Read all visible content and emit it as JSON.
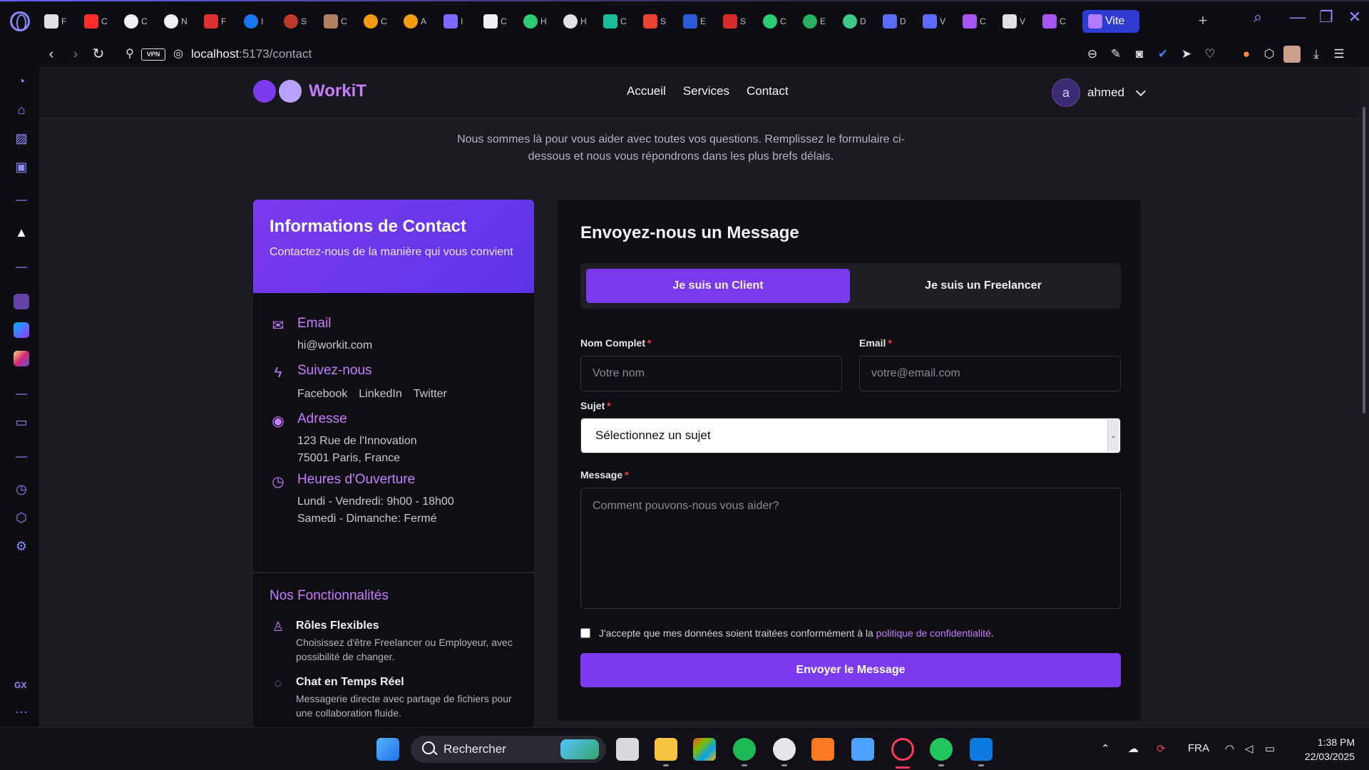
{
  "browser": {
    "active_tab_label": "Vite",
    "tab_letters": [
      "F",
      "C",
      "C",
      "N",
      "F",
      "I",
      "S",
      "C",
      "C",
      "A",
      "I",
      "C",
      "H",
      "H",
      "C",
      "S",
      "E",
      "S",
      "C",
      "E",
      "D",
      "D",
      "V",
      "C",
      "V",
      "C"
    ],
    "url_host": "localhost",
    "url_path": ":5173/contact",
    "vpn_label": "VPN",
    "new_tab": "+",
    "sidebar_gx": "GX",
    "sidebar_more": "···"
  },
  "header": {
    "logo": "WorkiT",
    "nav": [
      "Accueil",
      "Services",
      "Contact"
    ],
    "avatar_letter": "a",
    "username": "ahmed"
  },
  "intro": "Nous sommes là pour vous aider avec toutes vos questions. Remplissez le formulaire ci-dessous et nous vous répondrons dans les plus brefs délais.",
  "info": {
    "title": "Informations de Contact",
    "subtitle": "Contactez-nous de la manière qui vous convient",
    "email_title": "Email",
    "email_value": "hi@workit.com",
    "follow_title": "Suivez-nous",
    "follow_links": [
      "Facebook",
      "LinkedIn",
      "Twitter"
    ],
    "address_title": "Adresse",
    "address_line1": "123 Rue de l'Innovation",
    "address_line2": "75001 Paris, France",
    "hours_title": "Heures d'Ouverture",
    "hours_line1": "Lundi - Vendredi: 9h00 - 18h00",
    "hours_line2": "Samedi - Dimanche: Fermé",
    "features_title": "Nos Fonctionnalités",
    "features": [
      {
        "title": "Rôles Flexibles",
        "desc": "Choisissez d'être Freelancer ou Employeur, avec possibilité de changer."
      },
      {
        "title": "Chat en Temps Réel",
        "desc": "Messagerie directe avec partage de fichiers pour une collaboration fluide."
      }
    ]
  },
  "form": {
    "title": "Envoyez-nous un Message",
    "toggle_client": "Je suis un Client",
    "toggle_freelancer": "Je suis un Freelancer",
    "name_label": "Nom Complet",
    "name_placeholder": "Votre nom",
    "email_label": "Email",
    "email_placeholder": "votre@email.com",
    "subject_label": "Sujet",
    "subject_value": "Sélectionnez un sujet",
    "message_label": "Message",
    "message_placeholder": "Comment pouvons-nous vous aider?",
    "required_mark": "*",
    "consent_text": "J'accepte que mes données soient traitées conformément à la",
    "consent_link": "politique de confidentialité",
    "consent_end": ".",
    "submit": "Envoyer le Message"
  },
  "taskbar": {
    "search_label": "Rechercher",
    "lang": "FRA",
    "time": "1:38 PM",
    "date": "22/03/2025"
  },
  "colors": {
    "accent": "#7c3aed",
    "accent_light": "#c77dff",
    "required": "#ef4444"
  }
}
